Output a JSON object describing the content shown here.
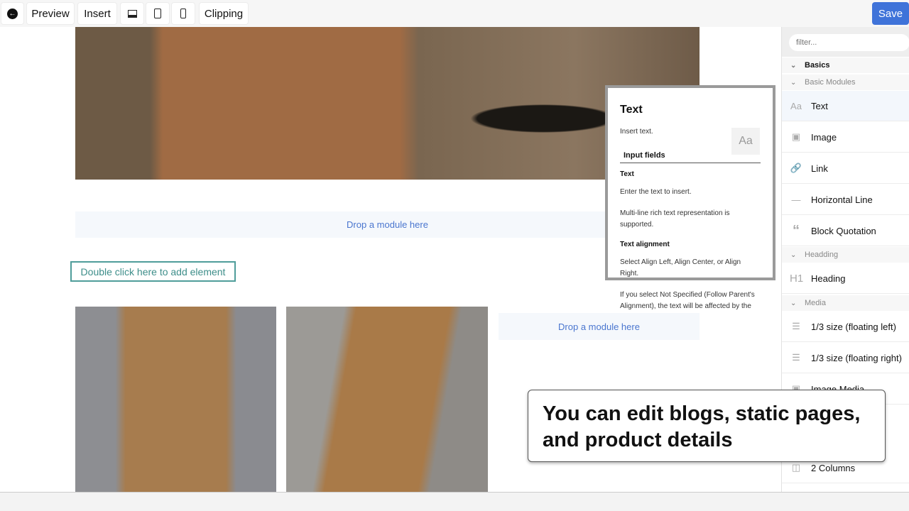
{
  "toolbar": {
    "back_icon": "arrow-left-circle-icon",
    "preview": "Preview",
    "insert": "Insert",
    "desktop_icon": "desktop-icon",
    "tablet_icon": "tablet-icon",
    "mobile_icon": "mobile-icon",
    "clipping": "Clipping",
    "save": "Save",
    "save_color": "#3f73d9"
  },
  "canvas": {
    "drop_label_1": "Drop a module here",
    "drop_label_2": "Drop a module here",
    "add_element": "Double click here to add element"
  },
  "help": {
    "title": "Text",
    "desc": "Insert text.",
    "icon": "Aa",
    "input_fields": "Input fields",
    "field1": "Text",
    "field1_p1": "Enter the text to insert.",
    "field1_p2": "Multi-line rich text representation is supported.",
    "field2": "Text alignment",
    "field2_p1": "Select Align Left, Align Center, or Align Right.",
    "field2_p2": "If you select Not Specified (Follow Parent's Alignment), the text will be affected by the"
  },
  "sidebar": {
    "filter_placeholder": "filter...",
    "basics": "Basics",
    "basic_modules": "Basic Modules",
    "items": [
      {
        "label": "Text",
        "icon": "Aa"
      },
      {
        "label": "Image",
        "icon": "image-icon"
      },
      {
        "label": "Link",
        "icon": "link-icon"
      },
      {
        "label": "Horizontal Line",
        "icon": "horizontal-line-icon"
      },
      {
        "label": "Block Quotation",
        "icon": "quote-icon"
      }
    ],
    "headding": "Headding",
    "heading_item": "Heading",
    "heading_icon": "H1",
    "media": "Media",
    "media_items": [
      {
        "label": "1/3 size (floating left)"
      },
      {
        "label": "1/3 size (floating right)"
      },
      {
        "label": "Image Media"
      }
    ],
    "columns": "2 Columns"
  },
  "callout": {
    "text": "You can edit blogs, static pages, and product details"
  }
}
